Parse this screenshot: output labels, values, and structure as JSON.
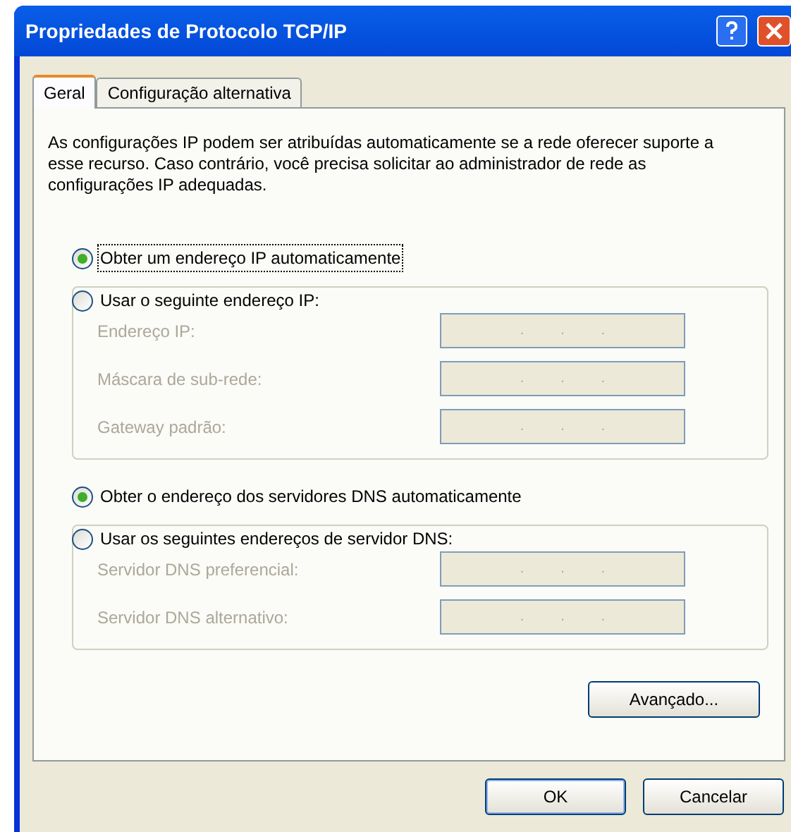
{
  "window": {
    "title": "Propriedades de Protocolo TCP/IP"
  },
  "tabs": [
    {
      "label": "Geral",
      "selected": true
    },
    {
      "label": "Configuração alternativa",
      "selected": false
    }
  ],
  "description": "As configurações IP podem ser atribuídas automaticamente se a rede oferecer suporte a esse recurso. Caso contrário, você precisa solicitar ao administrador de rede as configurações IP adequadas.",
  "ip_section": {
    "auto_option": {
      "label": "Obter um endereço IP automaticamente",
      "selected": true,
      "focused": true
    },
    "manual_option": {
      "label": "Usar o seguinte endereço IP:",
      "selected": false
    },
    "fields": [
      {
        "label": "Endereço IP:",
        "dots": [
          ".",
          ".",
          "."
        ],
        "disabled": true
      },
      {
        "label": "Máscara de sub-rede:",
        "dots": [
          ".",
          ".",
          "."
        ],
        "disabled": true
      },
      {
        "label": "Gateway padrão:",
        "dots": [
          ".",
          ".",
          "."
        ],
        "disabled": true
      }
    ]
  },
  "dns_section": {
    "auto_option": {
      "label": "Obter o endereço dos servidores DNS automaticamente",
      "selected": true,
      "focused": false
    },
    "manual_option": {
      "label": "Usar os seguintes endereços de servidor DNS:",
      "selected": false
    },
    "fields": [
      {
        "label": "Servidor DNS preferencial:",
        "dots": [
          ".",
          ".",
          "."
        ],
        "disabled": true
      },
      {
        "label": "Servidor DNS alternativo:",
        "dots": [
          ".",
          ".",
          "."
        ],
        "disabled": true
      }
    ]
  },
  "advanced_button": "Avançado...",
  "buttons": [
    "OK",
    "Cancelar"
  ]
}
